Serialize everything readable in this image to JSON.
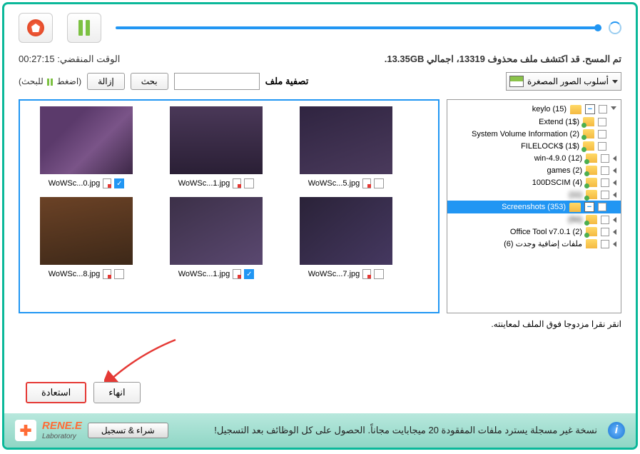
{
  "status": "تم المسح. قد اكتشف ملف محذوف 13319، اجمالي 13.35GB.",
  "elapsed_label": "الوقت المنقضي:",
  "elapsed_time": "00:27:15",
  "filter": {
    "label": "تصفية ملف",
    "search_btn": "بحث",
    "remove_btn": "إزالة",
    "hint_pre": "(اضغط",
    "hint_post": "للبحث)"
  },
  "view_mode": "أسلوب الصور المصغرة",
  "tree": [
    {
      "label": "keylo (15)",
      "expand": "-",
      "arrow": "down",
      "green": false
    },
    {
      "label": "Extend (1$)",
      "expand": "",
      "arrow": "",
      "green": true
    },
    {
      "label": "System Volume Information (2)",
      "expand": "",
      "arrow": "",
      "green": true
    },
    {
      "label": "FILELOCK$ (1$)",
      "expand": "",
      "arrow": "",
      "green": true
    },
    {
      "label": "win-4.9.0 (12)",
      "expand": "",
      "arrow": "left",
      "green": true
    },
    {
      "label": "games (2)",
      "expand": "",
      "arrow": "left",
      "green": true
    },
    {
      "label": "100DSCIM (4)",
      "expand": "",
      "arrow": "left",
      "green": true
    },
    {
      "label": "(11)",
      "expand": "",
      "arrow": "left",
      "green": true,
      "blur": true
    },
    {
      "label": "Screenshots (353)",
      "expand": "-",
      "arrow": "",
      "green": false,
      "sel": true
    },
    {
      "label": "(50)",
      "expand": "",
      "arrow": "left",
      "green": true,
      "blur": true
    },
    {
      "label": "Office Tool v7.0.1 (2)",
      "expand": "",
      "arrow": "left",
      "green": true
    },
    {
      "label": "ملفات إضافية وجدت (6)",
      "expand": "",
      "arrow": "left",
      "green": false
    }
  ],
  "thumbs": [
    {
      "name": "WoWSc...0.jpg",
      "checked": true,
      "cls": "t1"
    },
    {
      "name": "WoWSc...1.jpg",
      "checked": false,
      "cls": "t2"
    },
    {
      "name": "WoWSc...5.jpg",
      "checked": false,
      "cls": "t3"
    },
    {
      "name": "WoWSc...8.jpg",
      "checked": false,
      "cls": "t4"
    },
    {
      "name": "WoWSc...1.jpg",
      "checked": true,
      "cls": "t5"
    },
    {
      "name": "WoWSc...7.jpg",
      "checked": false,
      "cls": "t6"
    }
  ],
  "preview_hint": "انقر نقرا مزدوجا فوق الملف لمعاينته.",
  "buttons": {
    "recover": "استعادة",
    "finish": "انهاء"
  },
  "footer": {
    "brand": "RENE.E",
    "brand_sub": "Laboratory",
    "register": "شراء & تسجيل",
    "message": "نسخة غير مسجلة يسترد ملفات المفقودة 20 ميجابايت مجاناً. الحصول على كل الوظائف بعد التسجيل!"
  }
}
